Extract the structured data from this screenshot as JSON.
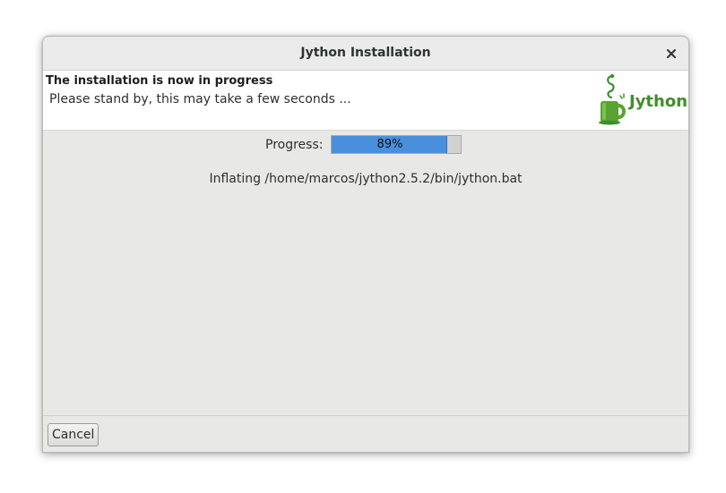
{
  "window": {
    "title": "Jython Installation"
  },
  "header": {
    "title": "The installation is now in progress",
    "subtitle": "Please stand by, this may take a few seconds ..."
  },
  "logo": {
    "icon": "jython-mug-icon",
    "text": "Jython",
    "color": "#3f8f2b"
  },
  "progress": {
    "label": "Progress:",
    "percent": 89,
    "percent_text": "89%",
    "fill_color": "#4a8fdc"
  },
  "status": {
    "text": "Inflating /home/marcos/jython2.5.2/bin/jython.bat"
  },
  "footer": {
    "cancel_label": "Cancel"
  }
}
